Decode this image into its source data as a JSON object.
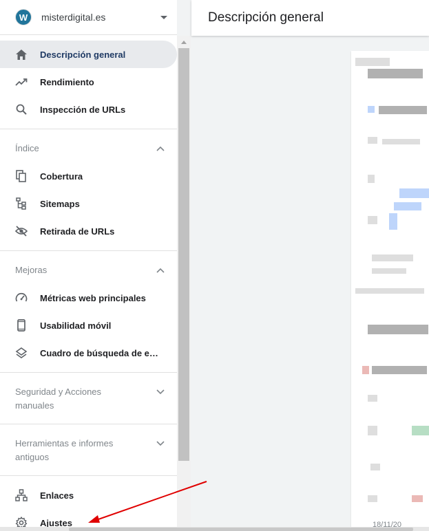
{
  "property": {
    "name": "misterdigital.es",
    "logo_letter": "W"
  },
  "header": {
    "title": "Descripción general"
  },
  "nav": {
    "main": [
      {
        "label": "Descripción general",
        "icon": "home-icon",
        "active": true
      },
      {
        "label": "Rendimiento",
        "icon": "trending-up-icon"
      },
      {
        "label": "Inspección de URLs",
        "icon": "search-icon"
      }
    ],
    "groups": [
      {
        "title": "Índice",
        "expanded": true,
        "items": [
          {
            "label": "Cobertura",
            "icon": "copy-icon"
          },
          {
            "label": "Sitemaps",
            "icon": "sitemap-icon"
          },
          {
            "label": "Retirada de URLs",
            "icon": "eye-off-icon"
          }
        ]
      },
      {
        "title": "Mejoras",
        "expanded": true,
        "items": [
          {
            "label": "Métricas web principales",
            "icon": "speedometer-icon"
          },
          {
            "label": "Usabilidad móvil",
            "icon": "smartphone-icon"
          },
          {
            "label": "Cuadro de búsqueda de enl…",
            "icon": "layers-icon"
          }
        ]
      },
      {
        "title": "Seguridad y Acciones manuales",
        "expanded": false
      },
      {
        "title": "Herramientas e informes antiguos",
        "expanded": false
      }
    ],
    "bottom": [
      {
        "label": "Enlaces",
        "icon": "network-icon"
      },
      {
        "label": "Ajustes",
        "icon": "gear-icon"
      }
    ]
  },
  "content": {
    "date_label": "18/11/20"
  },
  "colors": {
    "active_bg": "#e8eaed",
    "annotation_arrow": "#e00000",
    "wp_blue": "#21759b"
  }
}
